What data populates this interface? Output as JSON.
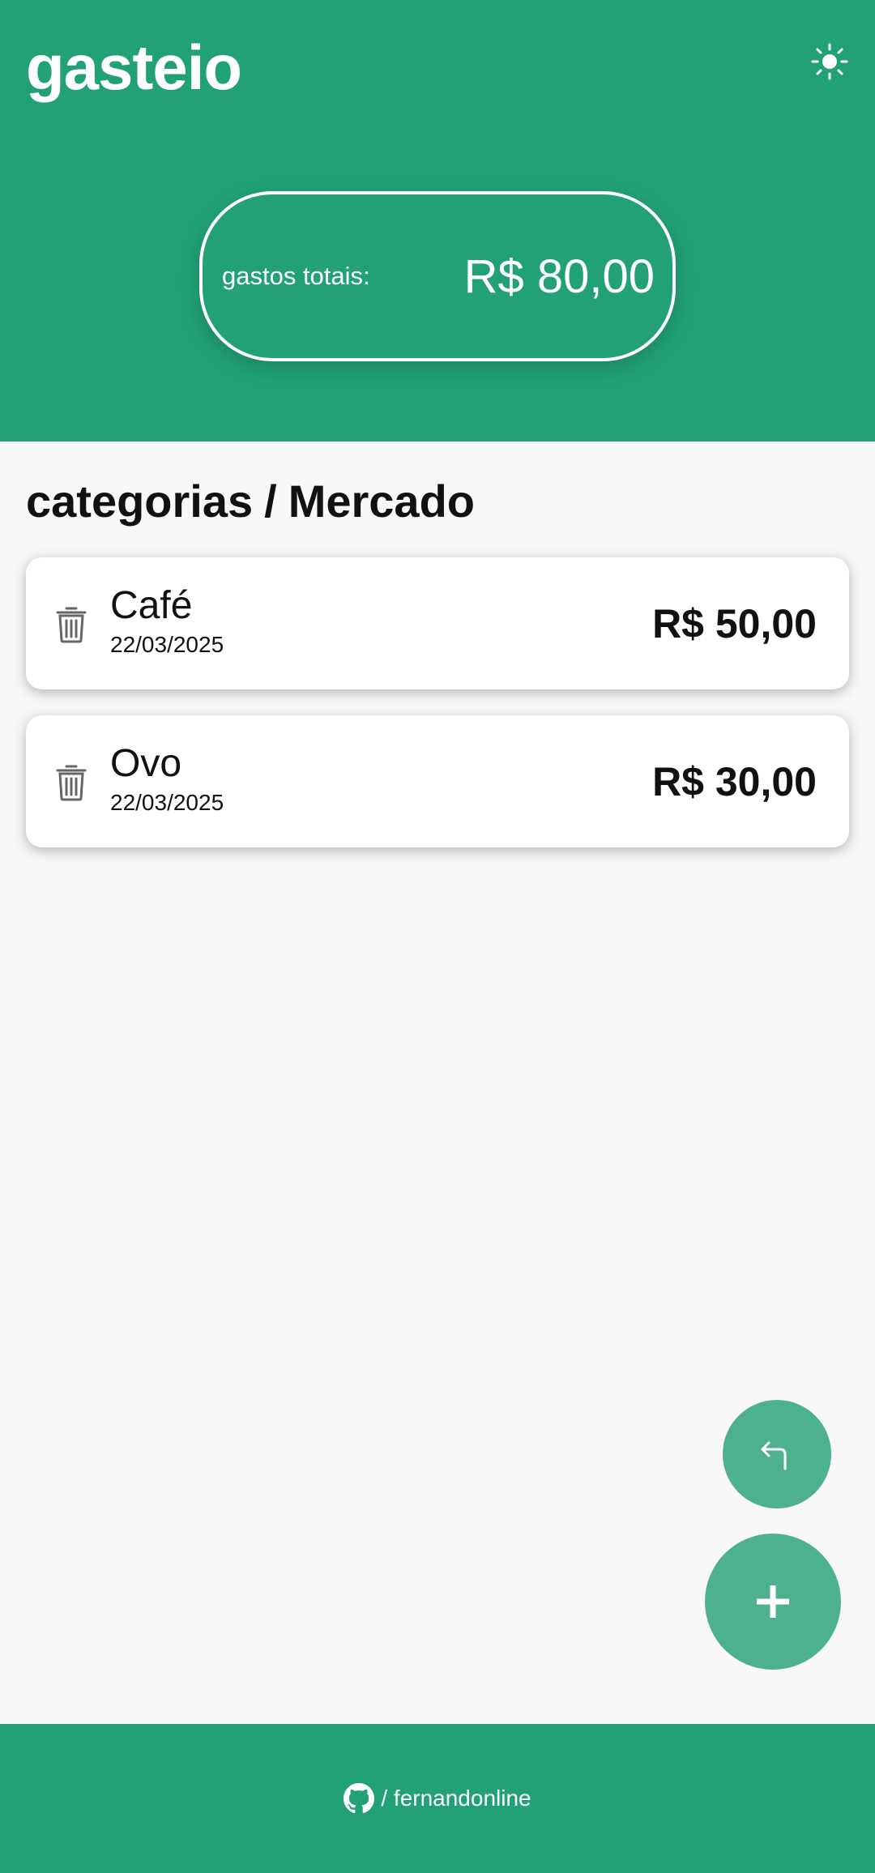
{
  "colors": {
    "primary": "#22a178",
    "fab": "#4db18f",
    "background": "#f8f8f8",
    "card": "#ffffff",
    "text": "#111111"
  },
  "header": {
    "brand": "gasteio",
    "theme_icon": "sun-icon",
    "total_label": "gastos totais:",
    "total_value": "R$ 80,00"
  },
  "breadcrumb": {
    "root": "categorias",
    "separator": "/",
    "current": "Mercado"
  },
  "items": [
    {
      "name": "Café",
      "date": "22/03/2025",
      "amount": "R$ 50,00"
    },
    {
      "name": "Ovo",
      "date": "22/03/2025",
      "amount": "R$ 30,00"
    }
  ],
  "fabs": {
    "back_icon": "return-arrow-icon",
    "add_icon": "plus-icon"
  },
  "footer": {
    "icon": "github-icon",
    "link_text": "/ fernandonline"
  }
}
